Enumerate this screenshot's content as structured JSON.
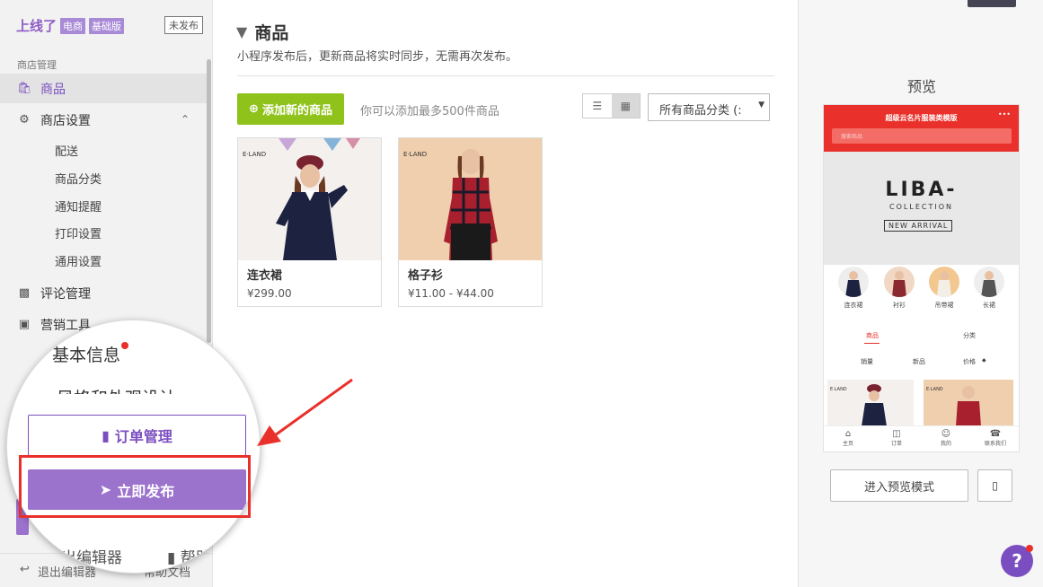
{
  "sidebar": {
    "brand": "上线了",
    "brand_tags": [
      "电商",
      "基础版"
    ],
    "status_badge": "未发布",
    "section_label": "商店管理",
    "items": [
      {
        "label": "商品",
        "icon": "bag-icon",
        "active": true
      },
      {
        "label": "商店设置",
        "icon": "gears-icon",
        "expanded": true
      },
      {
        "label": "评论管理",
        "icon": "comments-icon"
      },
      {
        "label": "营销工具",
        "icon": "gift-icon"
      }
    ],
    "sub_items": [
      "配送",
      "商品分类",
      "通知提醒",
      "打印设置",
      "通用设置"
    ],
    "bottom": {
      "exit": "退出编辑器",
      "docs": "帮助文档"
    }
  },
  "magnifier": {
    "basic_info": "基本信息",
    "style_design": "风格和外观设计",
    "order_button": "订单管理",
    "publish_button": "立即发布",
    "exit": "退出编辑器",
    "help": "帮助"
  },
  "main": {
    "title": "商品",
    "subtitle": "小程序发布后，更新商品将实时同步，无需再次发布。",
    "add_button": "添加新的商品",
    "hint": "你可以添加最多500件商品",
    "category_select": "所有商品分类 (:",
    "products": [
      {
        "name": "连衣裙",
        "price": "¥299.00",
        "brand": "E·LAND"
      },
      {
        "name": "格子衫",
        "price": "¥11.00 - ¥44.00",
        "brand": "E·LAND"
      }
    ]
  },
  "preview": {
    "title": "预览",
    "phone": {
      "header_title": "超级云名片服装类模版",
      "search_placeholder": "搜索商品",
      "banner_main": "LIBA-",
      "banner_sub": "COLLECTION",
      "banner_tag": "NEW ARRIVAL",
      "categories": [
        "连衣裙",
        "衬衫",
        "吊带裙",
        "长裙"
      ],
      "tabs": [
        "商品",
        "分类"
      ],
      "sorts": [
        "销量",
        "新品",
        "价格"
      ],
      "tabbar": [
        "主页",
        "订单",
        "我的",
        "联系我们"
      ],
      "brand": "E·LAND"
    },
    "enter_button": "进入预览模式"
  },
  "colors": {
    "accent": "#7a4ec0",
    "green": "#8fc21a",
    "red": "#e9302a"
  }
}
